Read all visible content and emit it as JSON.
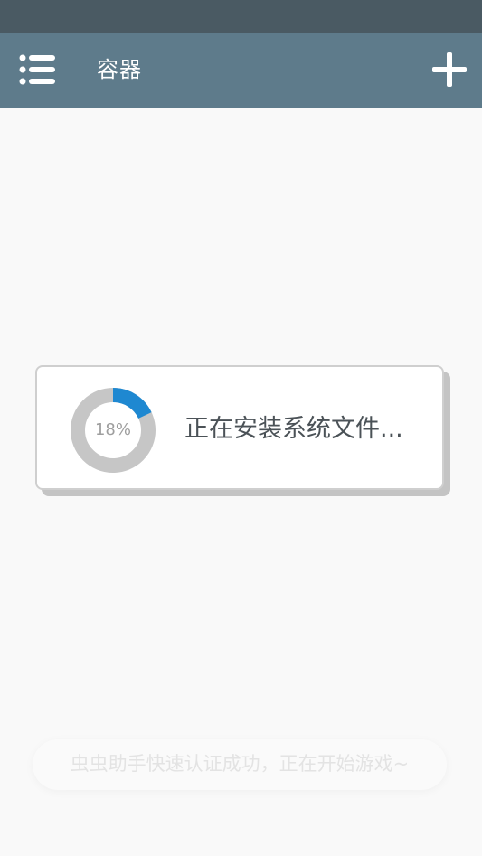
{
  "app_bar": {
    "title": "容器",
    "menu_icon": "list-menu-icon",
    "add_icon": "plus-icon",
    "background_color": "#5e7b8b"
  },
  "status_bar": {
    "background_color": "#4a5a63"
  },
  "progress_dialog": {
    "percent": 18,
    "percent_label": "18%",
    "message": "正在安装系统文件...",
    "progress_color": "#1e88d1",
    "track_color": "#c6c6c6"
  },
  "toast": {
    "message": "虫虫助手快速认证成功，正在开始游戏~"
  }
}
